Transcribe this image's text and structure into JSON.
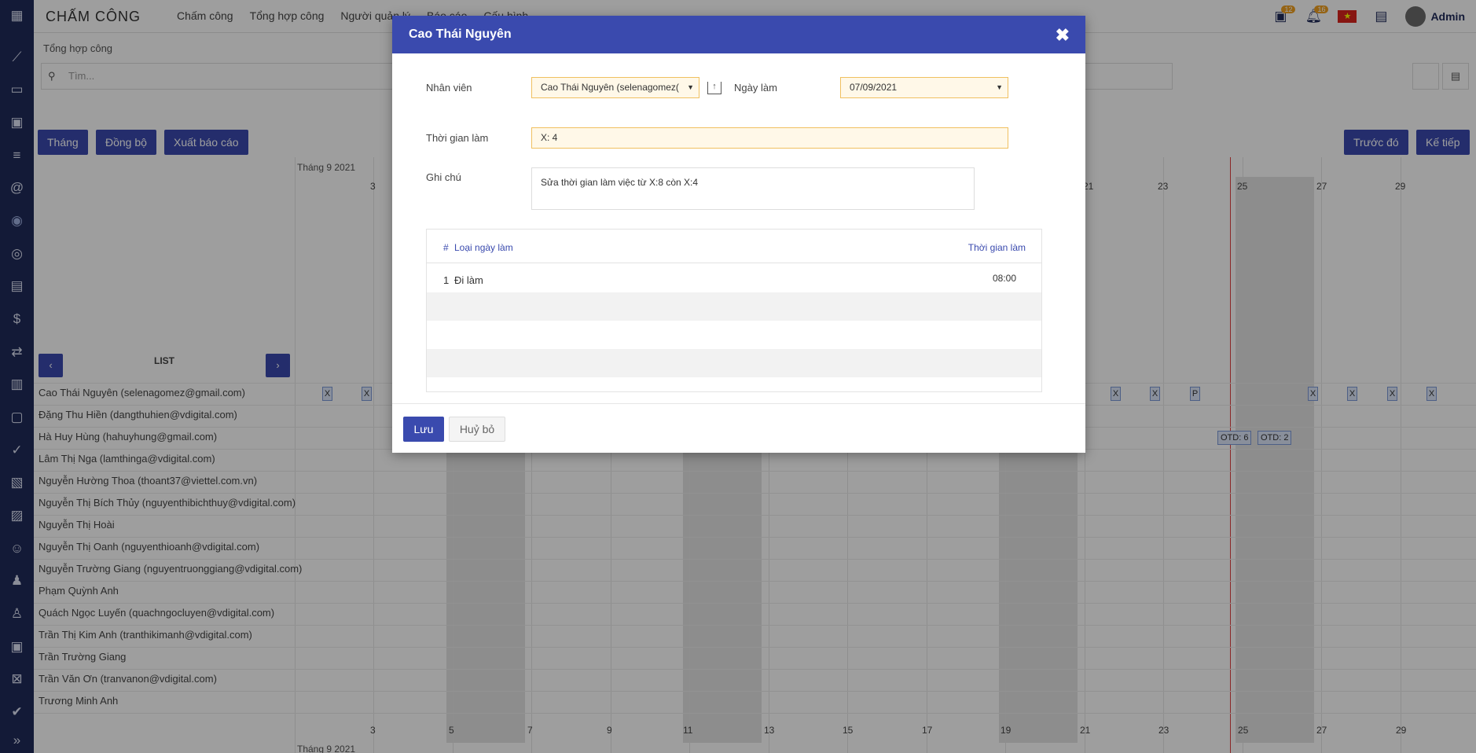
{
  "app": {
    "brand": "CHẤM CÔNG",
    "admin_label": "Admin"
  },
  "nav": [
    "Chấm công",
    "Tổng hợp công",
    "Người quản lý",
    "Báo cáo",
    "Cấu hình"
  ],
  "topbar": {
    "calendar_badge": "12",
    "bell_badge": "16",
    "flag": "★"
  },
  "page": {
    "breadcrumb": "Tổng hợp công",
    "search_placeholder": "Tìm...",
    "buttons": {
      "month": "Tháng",
      "sync": "Đồng bộ",
      "export": "Xuất báo cáo",
      "prev": "Trước đó",
      "next": "Kế tiếp"
    },
    "month_label": "Tháng 9 2021",
    "list_label": "LIST",
    "list_prev": "‹",
    "list_next": "›",
    "days_top": [
      "3",
      "21",
      "23",
      "25",
      "27",
      "29"
    ],
    "days_bottom": [
      "3",
      "5",
      "7",
      "9",
      "11",
      "13",
      "15",
      "17",
      "19",
      "21",
      "23",
      "25",
      "27",
      "29"
    ]
  },
  "employees": [
    "Cao Thái Nguyên (selenagomez@gmail.com)",
    "Đặng Thu Hiền (dangthuhien@vdigital.com)",
    "Hà Huy Hùng (hahuyhung@gmail.com)",
    "Lâm Thị Nga (lamthinga@vdigital.com)",
    "Nguyễn Hường Thoa (thoant37@viettel.com.vn)",
    "Nguyễn Thị Bích Thủy (nguyenthibichthuy@vdigital.com)",
    "Nguyễn Thị Hoài",
    "Nguyễn Thị Oanh (nguyenthioanh@vdigital.com)",
    "Nguyễn Trường Giang (nguyentruonggiang@vdigital.com)",
    "Phạm Quỳnh Anh",
    "Quách Ngọc Luyến (quachngocluyen@vdigital.com)",
    "Trần Thị Kim Anh (tranthikimanh@vdigital.com)",
    "Trần Trường Giang",
    "Trần Văn Ơn (tranvanon@vdigital.com)",
    "Trương Minh Anh"
  ],
  "cells": {
    "x": "X",
    "p": "P",
    "otd_a": "OTD: 6",
    "otd_b": "OTD: 2"
  },
  "modal": {
    "title": "Cao Thái Nguyên",
    "close": "✖",
    "employee_label": "Nhân viên",
    "employee_value": "Cao Thái Nguyên (selenagomez(",
    "date_label": "Ngày làm",
    "date_value": "07/09/2021",
    "time_label": "Thời gian làm",
    "time_value": "X: 4",
    "note_label": "Ghi chú",
    "note_value": "Sửa thời gian làm việc từ X:8 còn X:4",
    "table": {
      "col_index": "#",
      "col_type": "Loại ngày làm",
      "col_time": "Thời gian làm",
      "rows": [
        {
          "index": "1",
          "type": "Đi làm",
          "time": "08:00"
        }
      ]
    },
    "save": "Lưu",
    "cancel": "Huỷ bỏ"
  },
  "colors": {
    "primary": "#3a4aae",
    "rail": "#1f2a5a",
    "field_bg": "#fff8e8",
    "field_border": "#f0c060",
    "now_line": "#e04040"
  }
}
